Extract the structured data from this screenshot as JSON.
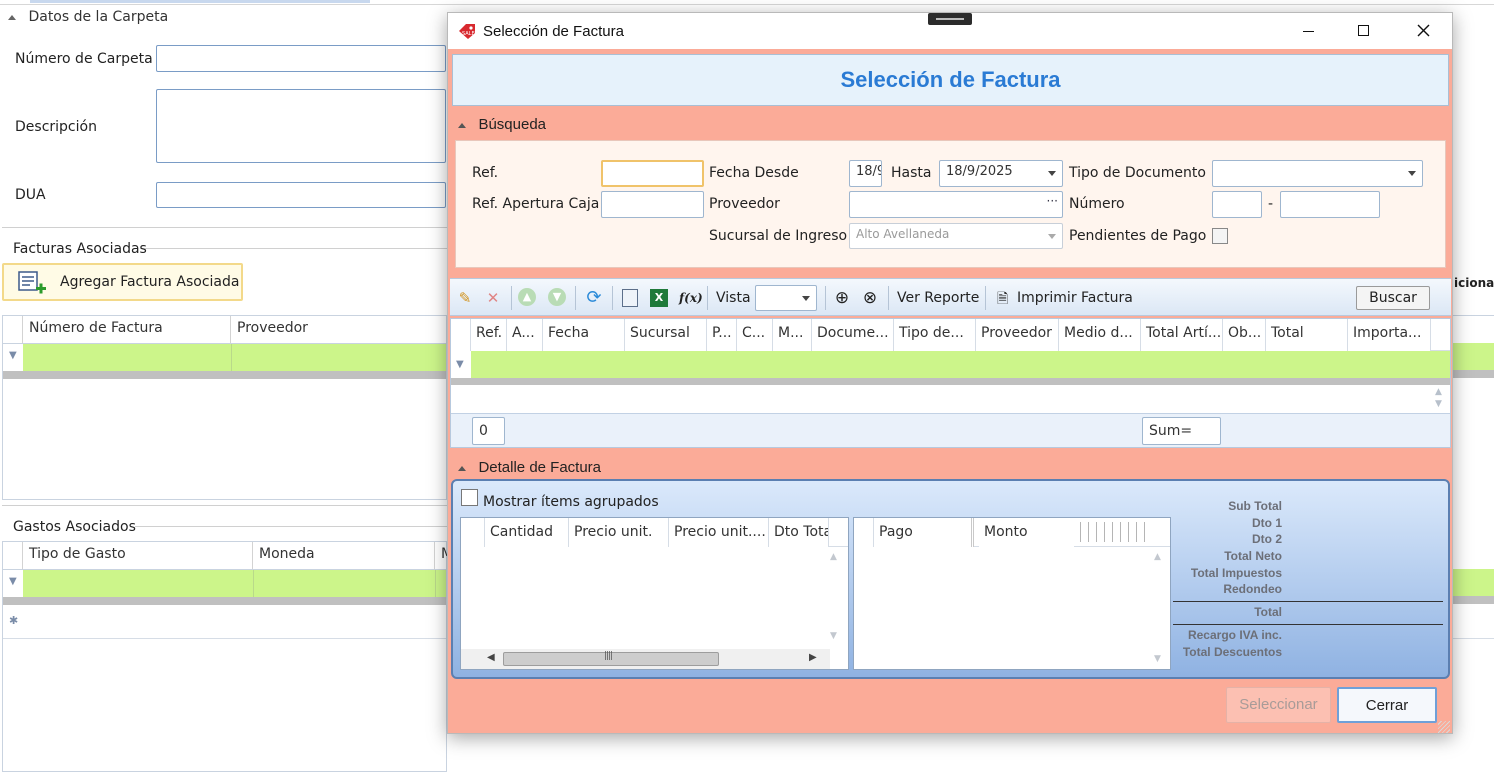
{
  "background": {
    "datos_title": "Datos de la Carpeta",
    "numero_carpeta_label": "Número de Carpeta",
    "descripcion_label": "Descripción",
    "dua_label": "DUA",
    "facturas_title": "Facturas Asociadas",
    "agregar_button": "Agregar Factura Asociada",
    "facturas_columns": [
      "Número de Factura",
      "Proveedor"
    ],
    "right_truncated": "icional",
    "gastos_title": "Gastos Asociados",
    "gastos_columns": [
      "Tipo de Gasto",
      "Moneda",
      "M"
    ]
  },
  "modal": {
    "window_title": "Selección de Factura",
    "banner_title": "Selección de Factura",
    "busqueda": {
      "title": "Búsqueda",
      "ref_label": "Ref.",
      "ref_value": "",
      "ref_apertura_label": "Ref. Apertura Caja",
      "fecha_desde_label": "Fecha Desde",
      "fecha_desde_value": "18/9",
      "hasta_label": "Hasta",
      "hasta_value": "18/9/2025",
      "proveedor_label": "Proveedor",
      "proveedor_ellipsis": "···",
      "sucursal_label": "Sucursal de Ingreso",
      "sucursal_value": "Alto Avellaneda",
      "tipo_documento_label": "Tipo de Documento",
      "numero_label": "Número",
      "numero_dash": "-",
      "pendientes_label": "Pendientes de Pago"
    },
    "toolbar": {
      "vista_label": "Vista",
      "ver_reporte": "Ver Reporte",
      "imprimir_factura": "Imprimir Factura",
      "buscar": "Buscar"
    },
    "grid": {
      "columns": [
        "Ref.",
        "A...",
        "Fecha",
        "Sucursal",
        "P...",
        "C...",
        "M...",
        "Docume...",
        "Tipo de...",
        "Proveedor",
        "Medio d...",
        "Total Artí...",
        "Ob...",
        "Total",
        "Importa..."
      ],
      "count_value": "0",
      "sum_label": "Sum="
    },
    "detalle": {
      "title": "Detalle de Factura",
      "mostrar_label": "Mostrar ítems agrupados",
      "items_columns": [
        "Cantidad",
        "Precio unit.",
        "Precio unit....",
        "Dto Tota"
      ],
      "pagos_columns": [
        "Pago",
        "Monto"
      ],
      "totals": [
        "Sub Total",
        "Dto 1",
        "Dto 2",
        "Total Neto",
        "Total Impuestos",
        "Redondeo",
        "Total",
        "Recargo IVA inc.",
        "Total Descuentos"
      ]
    },
    "buttons": {
      "seleccionar": "Seleccionar",
      "cerrar": "Cerrar"
    }
  },
  "colors": {
    "modal_bg": "#fbab98",
    "accent_blue": "#2a7bd4",
    "filter_green": "#ccf58a"
  }
}
